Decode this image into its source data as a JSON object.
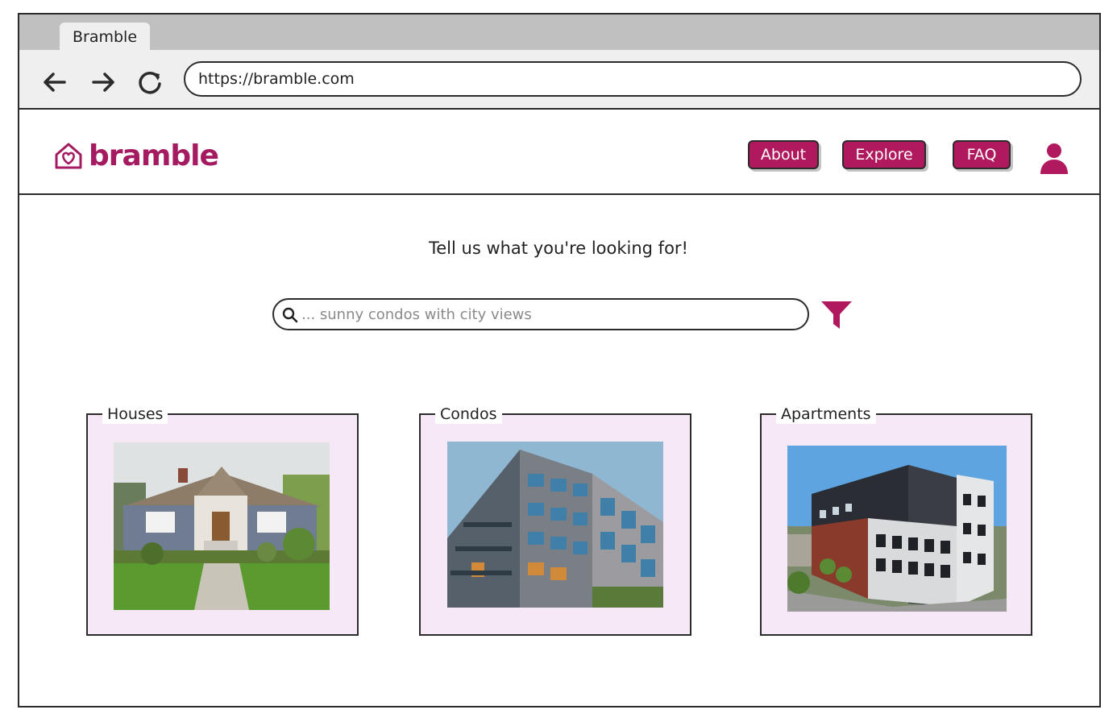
{
  "browser": {
    "tab_title": "Bramble",
    "url": "https://bramble.com",
    "icons": [
      "back-arrow-icon",
      "forward-arrow-icon",
      "reload-icon"
    ]
  },
  "header": {
    "logo_text": "bramble",
    "nav": [
      "About",
      "Explore",
      "FAQ"
    ],
    "user_icon": "user-icon"
  },
  "main": {
    "prompt": "Tell us what you're looking for!",
    "search": {
      "placeholder": "... sunny condos with city views",
      "value": ""
    },
    "filter_icon": "filter-funnel-icon"
  },
  "categories": [
    {
      "label": "Houses",
      "image": "house-photo"
    },
    {
      "label": "Condos",
      "image": "condo-building-photo"
    },
    {
      "label": "Apartments",
      "image": "apartment-building-photo"
    }
  ],
  "colors": {
    "accent": "#b0195d",
    "logo": "#a41b61",
    "card_bg": "#f7e8f8",
    "browser_chrome": "#efefef",
    "tab_strip": "#c0c0c0"
  }
}
